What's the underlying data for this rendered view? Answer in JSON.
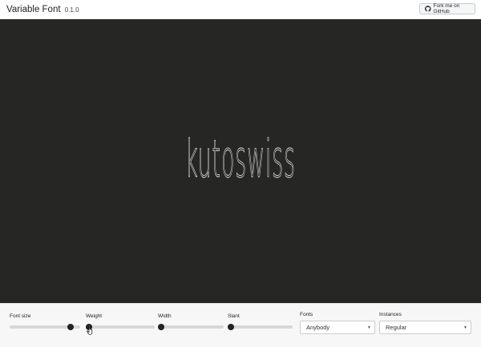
{
  "header": {
    "title": "Variable Font",
    "version": "0.1.0",
    "github_label": "Fork me on GitHub",
    "github_icon": "github-icon"
  },
  "preview": {
    "text": "kutoswiss",
    "background": "#262625",
    "text_color": "#e9e9e9"
  },
  "controls": {
    "sliders": [
      {
        "label": "Font size",
        "value": 0.86
      },
      {
        "label": "Weight",
        "value": 0.05
      },
      {
        "label": "Width",
        "value": 0.05
      },
      {
        "label": "Slant",
        "value": 0.05
      }
    ],
    "fonts": {
      "label": "Fonts",
      "selected": "Anybody"
    },
    "instances": {
      "label": "Instances",
      "selected": "Regular"
    }
  }
}
